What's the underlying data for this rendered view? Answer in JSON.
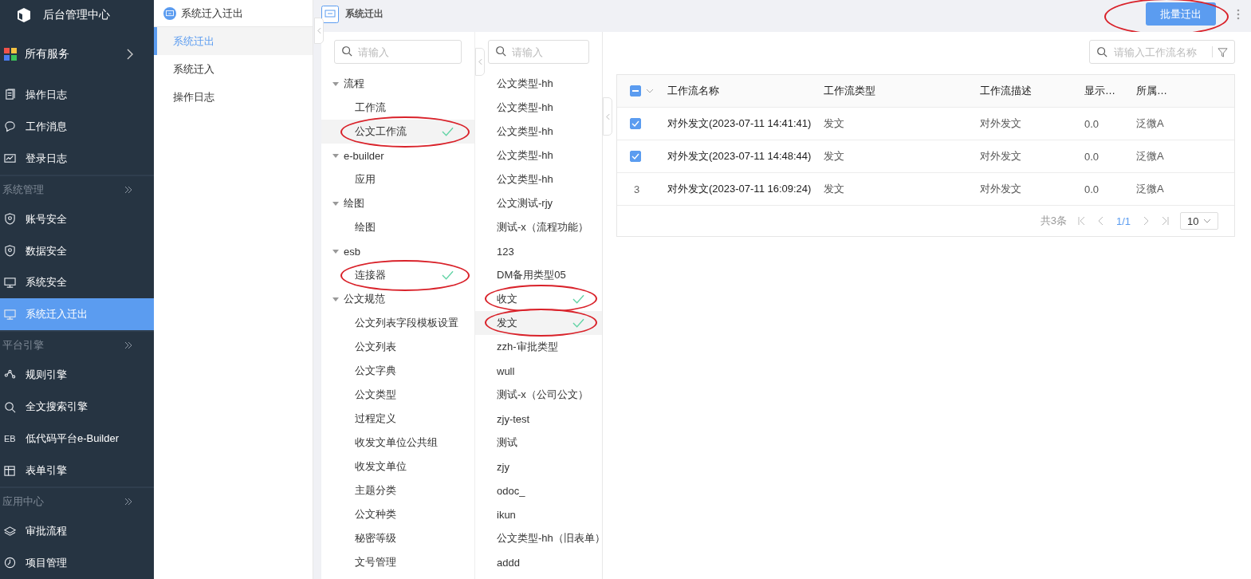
{
  "app": {
    "title": "后台管理中心"
  },
  "all_services": {
    "label": "所有服务"
  },
  "nav": [
    {
      "kind": "item",
      "label": "操作日志",
      "selected": false
    },
    {
      "kind": "item",
      "label": "工作消息",
      "selected": false
    },
    {
      "kind": "item",
      "label": "登录日志",
      "selected": false
    },
    {
      "kind": "group",
      "label": "系统管理"
    },
    {
      "kind": "item",
      "label": "账号安全",
      "selected": false
    },
    {
      "kind": "item",
      "label": "数据安全",
      "selected": false
    },
    {
      "kind": "item",
      "label": "系统安全",
      "selected": false
    },
    {
      "kind": "item",
      "label": "系统迁入迁出",
      "selected": true
    },
    {
      "kind": "group",
      "label": "平台引擎"
    },
    {
      "kind": "item",
      "label": "规则引擎",
      "selected": false
    },
    {
      "kind": "item",
      "label": "全文搜索引擎",
      "selected": false
    },
    {
      "kind": "item",
      "label": "低代码平台e-Builder",
      "selected": false,
      "icon_text": "EB"
    },
    {
      "kind": "item",
      "label": "表单引擎",
      "selected": false
    },
    {
      "kind": "group",
      "label": "应用中心"
    },
    {
      "kind": "item",
      "label": "审批流程",
      "selected": false
    },
    {
      "kind": "item",
      "label": "项目管理",
      "selected": false
    }
  ],
  "subnav": {
    "title": "系统迁入迁出",
    "items": [
      {
        "label": "系统迁出",
        "selected": true
      },
      {
        "label": "系统迁入",
        "selected": false
      },
      {
        "label": "操作日志",
        "selected": false
      }
    ]
  },
  "page": {
    "title": "系统迁出",
    "button": {
      "label": "批量迁出",
      "circled": true
    }
  },
  "tree": {
    "search": {
      "placeholder": "请输入"
    },
    "groups": [
      {
        "label": "流程",
        "expanded": true,
        "children": [
          {
            "label": "工作流",
            "selected": false,
            "checked": false,
            "circled": false
          },
          {
            "label": "公文工作流",
            "selected": true,
            "checked": true,
            "circled": true
          }
        ]
      },
      {
        "label": "e-builder",
        "expanded": true,
        "children": [
          {
            "label": "应用",
            "selected": false,
            "checked": false,
            "circled": false
          }
        ]
      },
      {
        "label": "绘图",
        "expanded": true,
        "children": [
          {
            "label": "绘图",
            "selected": false,
            "checked": false,
            "circled": false
          }
        ]
      },
      {
        "label": "esb",
        "expanded": true,
        "children": [
          {
            "label": "连接器",
            "selected": false,
            "checked": true,
            "circled": true
          }
        ]
      },
      {
        "label": "公文规范",
        "expanded": true,
        "children": [
          {
            "label": "公文列表字段模板设置",
            "selected": false,
            "checked": false,
            "circled": false
          },
          {
            "label": "公文列表",
            "selected": false,
            "checked": false,
            "circled": false
          },
          {
            "label": "公文字典",
            "selected": false,
            "checked": false,
            "circled": false
          },
          {
            "label": "公文类型",
            "selected": false,
            "checked": false,
            "circled": false
          },
          {
            "label": "过程定义",
            "selected": false,
            "checked": false,
            "circled": false
          },
          {
            "label": "收发文单位公共组",
            "selected": false,
            "checked": false,
            "circled": false
          },
          {
            "label": "收发文单位",
            "selected": false,
            "checked": false,
            "circled": false
          },
          {
            "label": "主题分类",
            "selected": false,
            "checked": false,
            "circled": false
          },
          {
            "label": "公文种类",
            "selected": false,
            "checked": false,
            "circled": false
          },
          {
            "label": "秘密等级",
            "selected": false,
            "checked": false,
            "circled": false
          },
          {
            "label": "文号管理",
            "selected": false,
            "checked": false,
            "circled": false
          }
        ]
      }
    ]
  },
  "types": {
    "search": {
      "placeholder": "请输入"
    },
    "items": [
      {
        "label": "公文类型-hh",
        "selected": false,
        "checked": false,
        "circled": false
      },
      {
        "label": "公文类型-hh",
        "selected": false,
        "checked": false,
        "circled": false
      },
      {
        "label": "公文类型-hh",
        "selected": false,
        "checked": false,
        "circled": false
      },
      {
        "label": "公文类型-hh",
        "selected": false,
        "checked": false,
        "circled": false
      },
      {
        "label": "公文类型-hh",
        "selected": false,
        "checked": false,
        "circled": false
      },
      {
        "label": "公文测试-rjy",
        "selected": false,
        "checked": false,
        "circled": false
      },
      {
        "label": "测试-x（流程功能）",
        "selected": false,
        "checked": false,
        "circled": false
      },
      {
        "label": "123",
        "selected": false,
        "checked": false,
        "circled": false
      },
      {
        "label": "DM备用类型05",
        "selected": false,
        "checked": false,
        "circled": false
      },
      {
        "label": "收文",
        "selected": false,
        "checked": true,
        "circled": true
      },
      {
        "label": "发文",
        "selected": true,
        "checked": true,
        "circled": true
      },
      {
        "label": "zzh-审批类型",
        "selected": false,
        "checked": false,
        "circled": false
      },
      {
        "label": "wull",
        "selected": false,
        "checked": false,
        "circled": false
      },
      {
        "label": "测试-x（公司公文）",
        "selected": false,
        "checked": false,
        "circled": false
      },
      {
        "label": "zjy-test",
        "selected": false,
        "checked": false,
        "circled": false
      },
      {
        "label": "测试",
        "selected": false,
        "checked": false,
        "circled": false
      },
      {
        "label": "zjy",
        "selected": false,
        "checked": false,
        "circled": false
      },
      {
        "label": "odoc_",
        "selected": false,
        "checked": false,
        "circled": false
      },
      {
        "label": "ikun",
        "selected": false,
        "checked": false,
        "circled": false
      },
      {
        "label": "公文类型-hh（旧表单）",
        "selected": false,
        "checked": false,
        "circled": false
      },
      {
        "label": "addd",
        "selected": false,
        "checked": false,
        "circled": false
      }
    ]
  },
  "table": {
    "search": {
      "placeholder": "请输入工作流名称"
    },
    "header_indeterminate": true,
    "columns": [
      "工作流名称",
      "工作流类型",
      "工作流描述",
      "显示…",
      "所属…"
    ],
    "rows": [
      {
        "checked": true,
        "cells": [
          "对外发文(2023-07-11 14:41:41)",
          "发文",
          "对外发文",
          "0.0",
          "泛微A"
        ]
      },
      {
        "checked": true,
        "cells": [
          "对外发文(2023-07-11 14:48:44)",
          "发文",
          "对外发文",
          "0.0",
          "泛微A"
        ]
      },
      {
        "checked": false,
        "number": "3",
        "cells": [
          "对外发文(2023-07-11 16:09:24)",
          "发文",
          "对外发文",
          "0.0",
          "泛微A"
        ]
      }
    ],
    "pagination": {
      "total": "共3条",
      "page": "1/1",
      "page_size": "10"
    }
  }
}
